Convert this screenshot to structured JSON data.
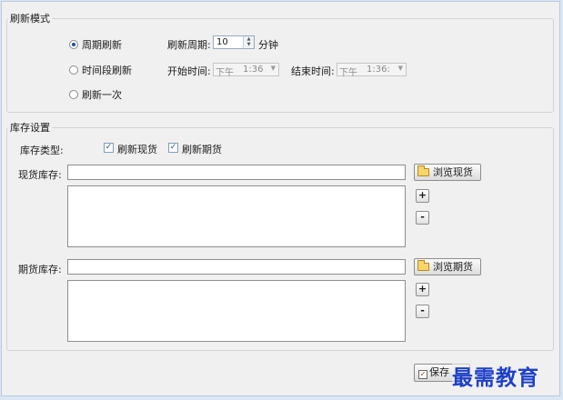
{
  "refresh_mode": {
    "title": "刷新模式",
    "options": [
      {
        "label": "周期刷新",
        "selected": true
      },
      {
        "label": "时间段刷新",
        "selected": false
      },
      {
        "label": "刷新一次",
        "selected": false
      }
    ],
    "period_label": "刷新周期:",
    "period_value": "10",
    "period_unit": "分钟",
    "start_label": "开始时间:",
    "start_ampm": "下午",
    "start_time": "1:36",
    "end_label": "结束时间:",
    "end_ampm": "下午",
    "end_time": "1:36:"
  },
  "stock": {
    "title": "库存设置",
    "type_label": "库存类型:",
    "checks": [
      {
        "label": "刷新现货",
        "checked": true
      },
      {
        "label": "刷新期货",
        "checked": true
      }
    ],
    "spot_label": "现货库存:",
    "spot_value": "",
    "browse_spot": "浏览现货",
    "futures_label": "期货库存:",
    "futures_value": "",
    "browse_futures": "浏览期货",
    "add_symbol": "+",
    "remove_symbol": "-"
  },
  "footer": {
    "save_label": "保存"
  },
  "watermark": "最需教育",
  "colors": {
    "accent": "#1d4fa1",
    "watermark": "#1e40c8"
  }
}
